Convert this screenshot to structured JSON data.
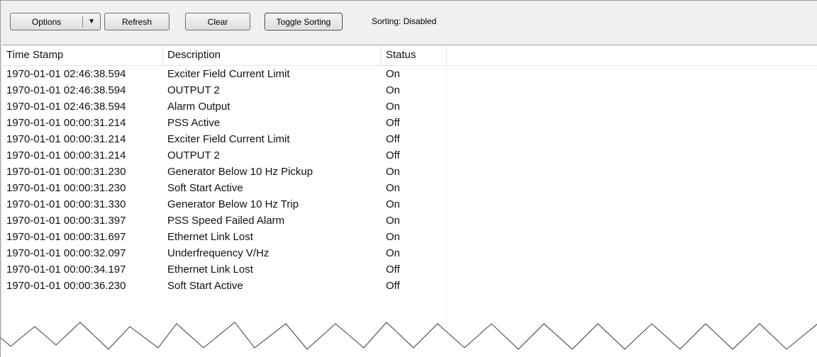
{
  "toolbar": {
    "options_label": "Options",
    "refresh_label": "Refresh",
    "clear_label": "Clear",
    "toggle_label": "Toggle Sorting",
    "sorting_status": "Sorting: Disabled"
  },
  "table": {
    "columns": [
      "Time Stamp",
      "Description",
      "Status"
    ],
    "rows": [
      {
        "time": "1970-01-01 02:46:38.594",
        "desc": "Exciter Field Current Limit",
        "status": "On"
      },
      {
        "time": "1970-01-01 02:46:38.594",
        "desc": "OUTPUT 2",
        "status": "On"
      },
      {
        "time": "1970-01-01 02:46:38.594",
        "desc": "Alarm Output",
        "status": "On"
      },
      {
        "time": "1970-01-01 00:00:31.214",
        "desc": "PSS Active",
        "status": "Off"
      },
      {
        "time": "1970-01-01 00:00:31.214",
        "desc": "Exciter Field Current Limit",
        "status": "Off"
      },
      {
        "time": "1970-01-01 00:00:31.214",
        "desc": "OUTPUT 2",
        "status": "Off"
      },
      {
        "time": "1970-01-01 00:00:31.230",
        "desc": "Generator Below 10 Hz Pickup",
        "status": "On"
      },
      {
        "time": "1970-01-01 00:00:31.230",
        "desc": "Soft Start Active",
        "status": "On"
      },
      {
        "time": "1970-01-01 00:00:31.330",
        "desc": "Generator Below 10 Hz Trip",
        "status": "On"
      },
      {
        "time": "1970-01-01 00:00:31.397",
        "desc": "PSS Speed Failed Alarm",
        "status": "On"
      },
      {
        "time": "1970-01-01 00:00:31.697",
        "desc": "Ethernet Link Lost",
        "status": "On"
      },
      {
        "time": "1970-01-01 00:00:32.097",
        "desc": "Underfrequency V/Hz",
        "status": "On"
      },
      {
        "time": "1970-01-01 00:00:34.197",
        "desc": "Ethernet Link Lost",
        "status": "Off"
      },
      {
        "time": "1970-01-01 00:00:36.230",
        "desc": "Soft Start Active",
        "status": "Off"
      }
    ]
  }
}
